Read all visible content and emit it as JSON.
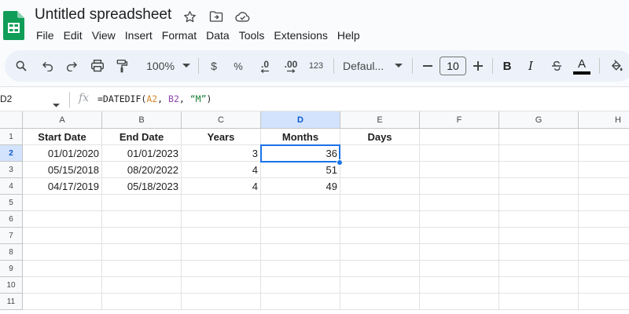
{
  "app": {
    "title": "Untitled spreadsheet",
    "brand_color": "#0f9d58",
    "icons": [
      "star-icon",
      "move-to-folder-icon",
      "cloud-saved-icon"
    ]
  },
  "menu": [
    "File",
    "Edit",
    "View",
    "Insert",
    "Format",
    "Data",
    "Tools",
    "Extensions",
    "Help"
  ],
  "toolbar": {
    "zoom": "100%",
    "currency": "$",
    "percent": "%",
    "decrease_decimal": ".0",
    "increase_decimal": ".00",
    "number_format": "123",
    "font": "Defaul...",
    "font_size": "10",
    "bold": "B",
    "italic": "I",
    "text_color_letter": "A",
    "text_color": "#000000"
  },
  "formula_bar": {
    "name_box": "D2",
    "fx": "fx",
    "formula_parts": [
      "=DATEDIF(",
      "A2",
      ", ",
      "B2",
      ", ",
      "“M”",
      ")"
    ]
  },
  "grid": {
    "columns": [
      "A",
      "B",
      "C",
      "D",
      "E",
      "F",
      "G",
      "H"
    ],
    "rows": [
      "1",
      "2",
      "3",
      "4",
      "5",
      "6",
      "7",
      "8",
      "9",
      "10",
      "11"
    ],
    "selected_column": "D",
    "selected_row": "2",
    "headers": [
      "Start Date",
      "End Date",
      "Years",
      "Months",
      "Days"
    ],
    "data": [
      [
        "01/01/2020",
        "01/01/2023",
        "3",
        "36"
      ],
      [
        "05/15/2018",
        "08/20/2022",
        "4",
        "51"
      ],
      [
        "04/17/2019",
        "05/18/2023",
        "4",
        "49"
      ]
    ]
  },
  "colors": {
    "selection": "#1a73e8",
    "selected_header_bg": "#d3e3fd",
    "toolbar_bg": "#edf2fa"
  }
}
